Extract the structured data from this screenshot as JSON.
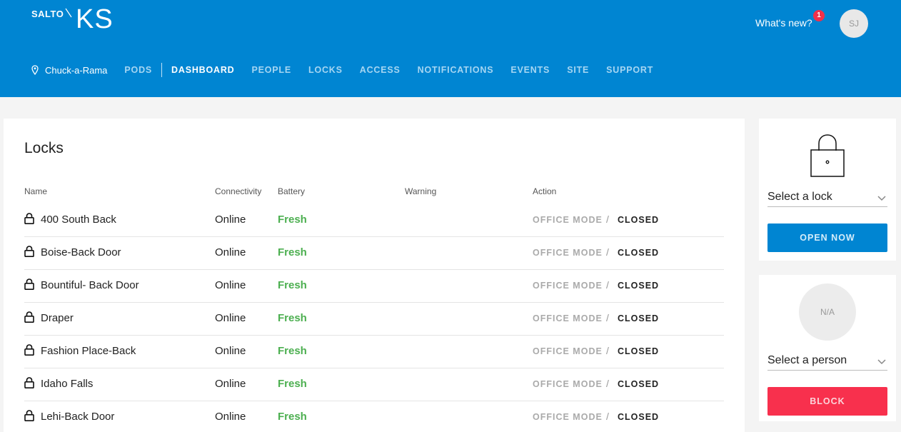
{
  "brand": {
    "salto": "SALTO",
    "ks": "KS"
  },
  "header": {
    "whats_new": "What's new?",
    "notification_count": "1",
    "user_initials": "SJ"
  },
  "nav": {
    "site_name": "Chuck-a-Rama",
    "items": [
      {
        "label": "PODS",
        "active": false
      },
      {
        "label": "DASHBOARD",
        "active": true
      },
      {
        "label": "PEOPLE",
        "active": false
      },
      {
        "label": "LOCKS",
        "active": false
      },
      {
        "label": "ACCESS",
        "active": false
      },
      {
        "label": "NOTIFICATIONS",
        "active": false
      },
      {
        "label": "EVENTS",
        "active": false
      },
      {
        "label": "SITE",
        "active": false
      },
      {
        "label": "SUPPORT",
        "active": false
      }
    ]
  },
  "locks_card": {
    "title": "Locks",
    "columns": {
      "name": "Name",
      "connectivity": "Connectivity",
      "battery": "Battery",
      "warning": "Warning",
      "action": "Action"
    },
    "office_mode_label": "OFFICE MODE",
    "separator": "/",
    "closed_label": "CLOSED",
    "rows": [
      {
        "name": "400 South Back",
        "connectivity": "Online",
        "battery": "Fresh",
        "warning": ""
      },
      {
        "name": "Boise-Back Door",
        "connectivity": "Online",
        "battery": "Fresh",
        "warning": ""
      },
      {
        "name": "Bountiful- Back Door",
        "connectivity": "Online",
        "battery": "Fresh",
        "warning": ""
      },
      {
        "name": "Draper",
        "connectivity": "Online",
        "battery": "Fresh",
        "warning": ""
      },
      {
        "name": "Fashion Place-Back",
        "connectivity": "Online",
        "battery": "Fresh",
        "warning": ""
      },
      {
        "name": "Idaho Falls",
        "connectivity": "Online",
        "battery": "Fresh",
        "warning": ""
      },
      {
        "name": "Lehi-Back Door",
        "connectivity": "Online",
        "battery": "Fresh",
        "warning": ""
      }
    ]
  },
  "lock_panel": {
    "select_label": "Select a lock",
    "open_button": "OPEN NOW"
  },
  "person_panel": {
    "avatar_text": "N/A",
    "select_label": "Select a person",
    "block_button": "BLOCK"
  },
  "colors": {
    "header_bg": "#0085d2",
    "battery_fresh": "#4caf50",
    "block_button": "#f8304d",
    "notification_badge": "#f0304a"
  },
  "icons": {
    "site_pin": "map-pin-icon",
    "row_lock": "padlock-icon",
    "panel_lock": "padlock-icon",
    "select_chevron": "chevron-down-icon"
  }
}
